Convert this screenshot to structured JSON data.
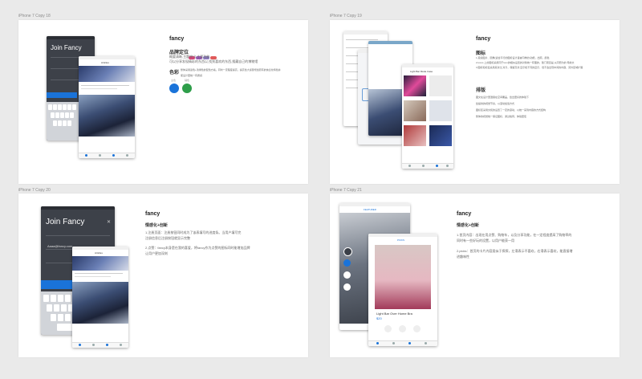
{
  "boards": [
    {
      "label": "iPhone 7 Copy 18"
    },
    {
      "label": "iPhone 7 Copy 19"
    },
    {
      "label": "iPhone 7 Copy 20"
    },
    {
      "label": "iPhone 7 Copy 21"
    }
  ],
  "b1": {
    "join": "Join Fancy",
    "title": "fancy",
    "brand_label": "品牌定位",
    "brand_lines": [
      "概要清晰,主题突出,主要功能",
      "可以分享发现精彩的东西以,找到喜欢的东西,搜藏自己的博物馆"
    ],
    "color_label": "色彩",
    "color_lines": [
      "整体采用蓝色+浅绿色的配色方案。同时一定程度提高，提高性大感受增加原有的信息化特色并",
      "使设计更统一有质感"
    ],
    "color_names": [
      "主色",
      "辅色"
    ],
    "colors": {
      "primary": "#1a73d9",
      "secondary": "#2e9e4a",
      "tag1": "#e0457b",
      "tag2": "#9b59b6",
      "tag3": "#8e7cc3",
      "tag4": "#e05a5a"
    },
    "card_title": "Articles"
  },
  "b2": {
    "title": "fancy",
    "icon_label": "图标",
    "icon_lines": [
      "1.延续图片、圆角(适合平行的图标设计语言同样的)功能，出照，颜色",
      "2.icons 上的图标采用同于icon的相似设置的对象统一有理的，随门项目是 从同而为的 导航文",
      "3.图标和标签采用来对比,对齐，保留高清,显示和不同的显示，但不会出现中间的内容，另外区域扩展"
    ],
    "layout_label": "排版",
    "layout_lines": [
      "图文在设计里遵循在空间覆盖，给出更好的体验下",
      "给提供的视觉节奏，以滚动加载方式",
      "图标区采用文和的设置了一定的滚动，以统一来到内容的方式结构",
      "整体的视觉统一保证图标，通过格局，体验更佳"
    ],
    "banner": "Light Bar Mode Case"
  },
  "b3": {
    "join": "Join Fancy",
    "email": "Aaaa@fancy.com",
    "title": "fancy",
    "sub": "情感化+创新",
    "lines": [
      "1.注册页面：注册按钮同时成为了该表填写的进度条。当用户填写完",
      "注册信息后注册按钮就显示完整",
      "2.点赞：fancy本身是在我的喜爱，将fancy作为点赞的图标同时能增加品牌",
      "让用户更加深刻"
    ],
    "card_title": "Articles"
  },
  "b4": {
    "title": "fancy",
    "sub": "情感化+创新",
    "lines": [
      "1.首页内容：出现在用点赞、购物车，以及分享功能，在一定程度提高了购物率的",
      "同时有一些好玩的设置，以用户能获一用",
      "2.picks：首页的卡片内容类似于探探，左滑表示不喜欢，右滑表示喜欢，能直接增",
      "进趣味性"
    ],
    "product_name": "Light Bar Over Home Bra",
    "product_price": "$20",
    "tab_label": "FEATURED"
  }
}
